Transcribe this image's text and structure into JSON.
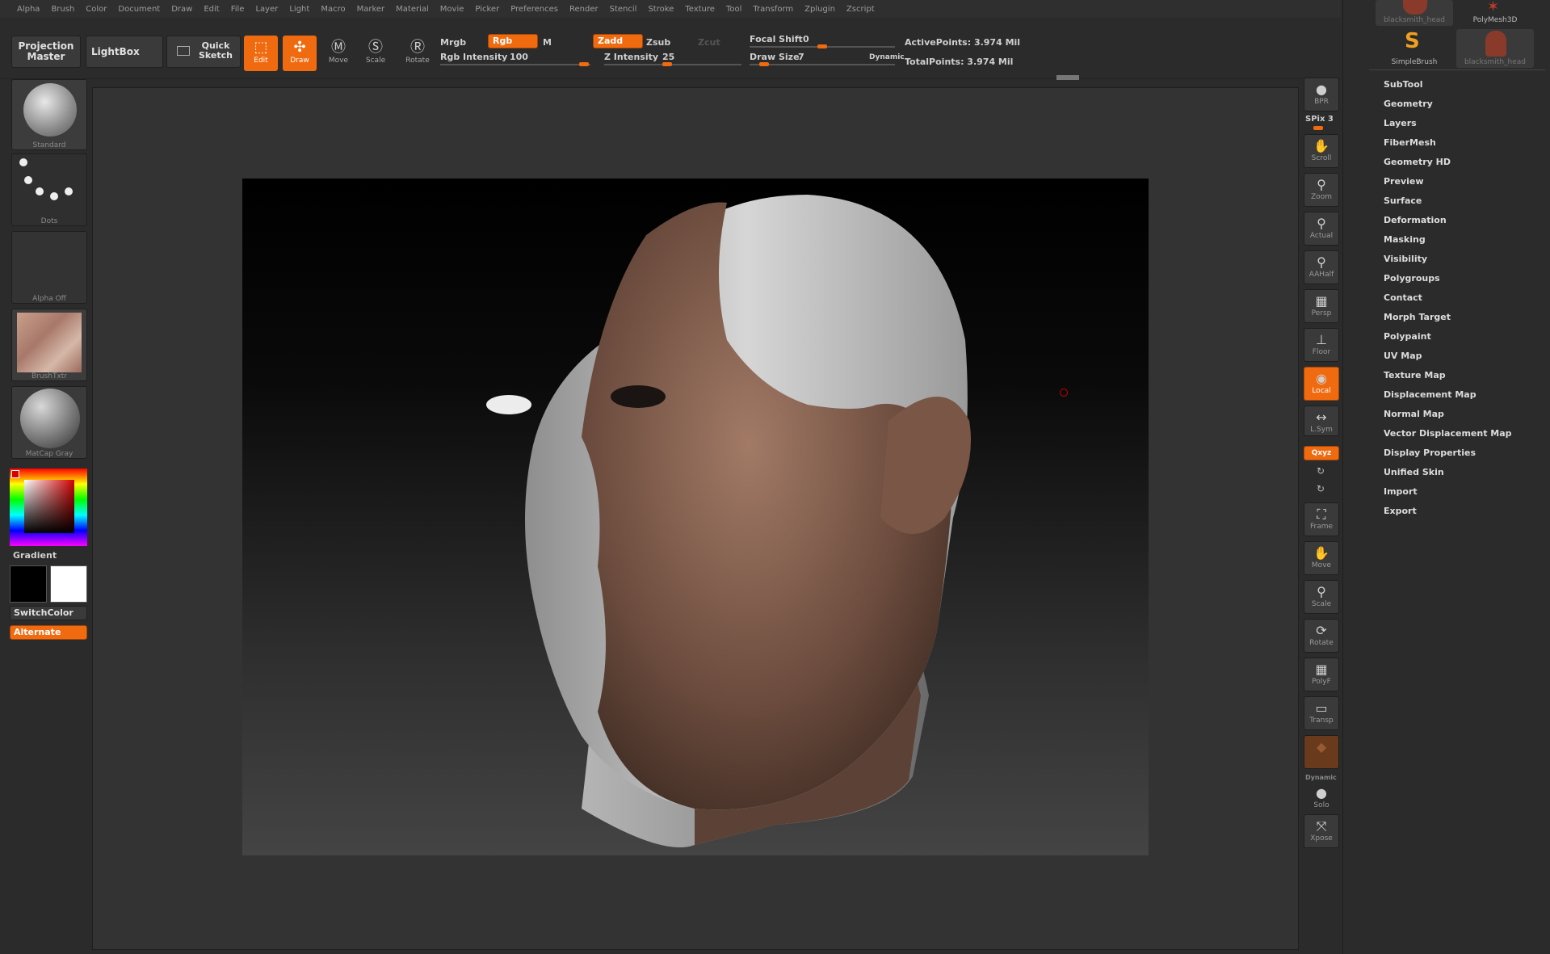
{
  "menu": [
    "Alpha",
    "Brush",
    "Color",
    "Document",
    "Draw",
    "Edit",
    "File",
    "Layer",
    "Light",
    "Macro",
    "Marker",
    "Material",
    "Movie",
    "Picker",
    "Preferences",
    "Render",
    "Stencil",
    "Stroke",
    "Texture",
    "Tool",
    "Transform",
    "Zplugin",
    "Zscript"
  ],
  "shelf": {
    "projection_master": "Projection Master",
    "lightbox": "LightBox",
    "quick_sketch": "Quick Sketch",
    "edit": "Edit",
    "draw": "Draw",
    "move": "Move",
    "scale": "Scale",
    "rotate": "Rotate",
    "mrgb": "Mrgb",
    "rgb": "Rgb",
    "m": "M",
    "rgb_intensity_label": "Rgb Intensity",
    "rgb_intensity_value": "100",
    "zadd": "Zadd",
    "zsub": "Zsub",
    "zcut": "Zcut",
    "z_intensity_label": "Z Intensity",
    "z_intensity_value": "25",
    "focal_shift_label": "Focal Shift",
    "focal_shift_value": "0",
    "draw_size_label": "Draw Size",
    "draw_size_value": "7",
    "dynamic": "Dynamic",
    "active_points": "ActivePoints: 3.974 Mil",
    "total_points": "TotalPoints: 3.974 Mil",
    "accent": "#f06a0f"
  },
  "left": {
    "brush": "Standard",
    "stroke": "Dots",
    "alpha": "Alpha Off",
    "texture": "BrushTxtr",
    "material": "MatCap Gray",
    "gradient": "Gradient",
    "switch_color": "SwitchColor",
    "alternate": "Alternate"
  },
  "right_tools": {
    "bpr": "BPR",
    "spix": "SPix 3",
    "scroll": "Scroll",
    "zoom": "Zoom",
    "actual": "Actual",
    "aahalf": "AAHalf",
    "persp": "Persp",
    "floor": "Floor",
    "local": "Local",
    "lsym": "L.Sym",
    "xyz": "Qxyz",
    "frame": "Frame",
    "move": "Move",
    "scale": "Scale",
    "rotate": "Rotate",
    "polyf": "PolyF",
    "transp": "Transp",
    "dynamic": "Dynamic",
    "solo": "Solo",
    "xpose": "Xpose"
  },
  "tool_panel": {
    "thumbs": [
      "blacksmith_head",
      "PolyMesh3D",
      "SimpleBrush",
      "blacksmith_head"
    ],
    "items": [
      "SubTool",
      "Geometry",
      "Layers",
      "FiberMesh",
      "Geometry HD",
      "Preview",
      "Surface",
      "Deformation",
      "Masking",
      "Visibility",
      "Polygroups",
      "Contact",
      "Morph Target",
      "Polypaint",
      "UV Map",
      "Texture Map",
      "Displacement Map",
      "Normal Map",
      "Vector Displacement Map",
      "Display Properties",
      "Unified Skin",
      "Import",
      "Export"
    ]
  }
}
